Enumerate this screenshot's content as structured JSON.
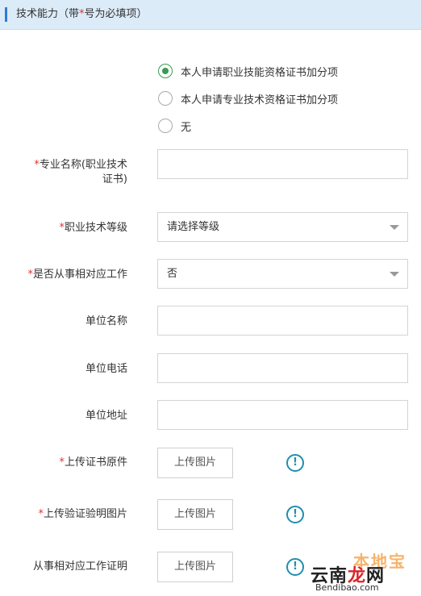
{
  "header": {
    "title_prefix": "技术能力（带",
    "title_star": "*",
    "title_suffix": "号为必填项）"
  },
  "radio_options": [
    {
      "label": "本人申请职业技能资格证书加分项",
      "checked": true
    },
    {
      "label": "本人申请专业技术资格证书加分项",
      "checked": false
    },
    {
      "label": "无",
      "checked": false
    }
  ],
  "form": {
    "major_name": {
      "star": "*",
      "label_line1": "专业名称(职业技术",
      "label_line2": "证书)",
      "value": ""
    },
    "tech_level": {
      "star": "*",
      "label": "职业技术等级",
      "value": "请选择等级"
    },
    "engaged_work": {
      "star": "*",
      "label": "是否从事相对应工作",
      "value": "否"
    },
    "unit_name": {
      "label": "单位名称",
      "value": ""
    },
    "unit_phone": {
      "label": "单位电话",
      "value": ""
    },
    "unit_address": {
      "label": "单位地址",
      "value": ""
    },
    "upload_certificate": {
      "star": "*",
      "label": "上传证书原件",
      "button": "上传图片"
    },
    "upload_verification": {
      "star": "*",
      "label": "上传验证验明图片",
      "button": "上传图片"
    },
    "upload_work_proof": {
      "label": "从事相对应工作证明",
      "button": "上传图片"
    }
  },
  "icons": {
    "info": "exclamation-circle-icon",
    "info_glyph": "!",
    "info_color": "#1f8fae"
  },
  "colors": {
    "header_bg": "#dcebf8",
    "accent": "#2e7bd6",
    "required_star": "#e0322f",
    "radio_checked": "#3a9a52"
  },
  "watermark": {
    "top": "本地宝",
    "main_part1": "云南",
    "main_part2": "龙",
    "main_part3": "网",
    "url": "Bendibao.com"
  }
}
